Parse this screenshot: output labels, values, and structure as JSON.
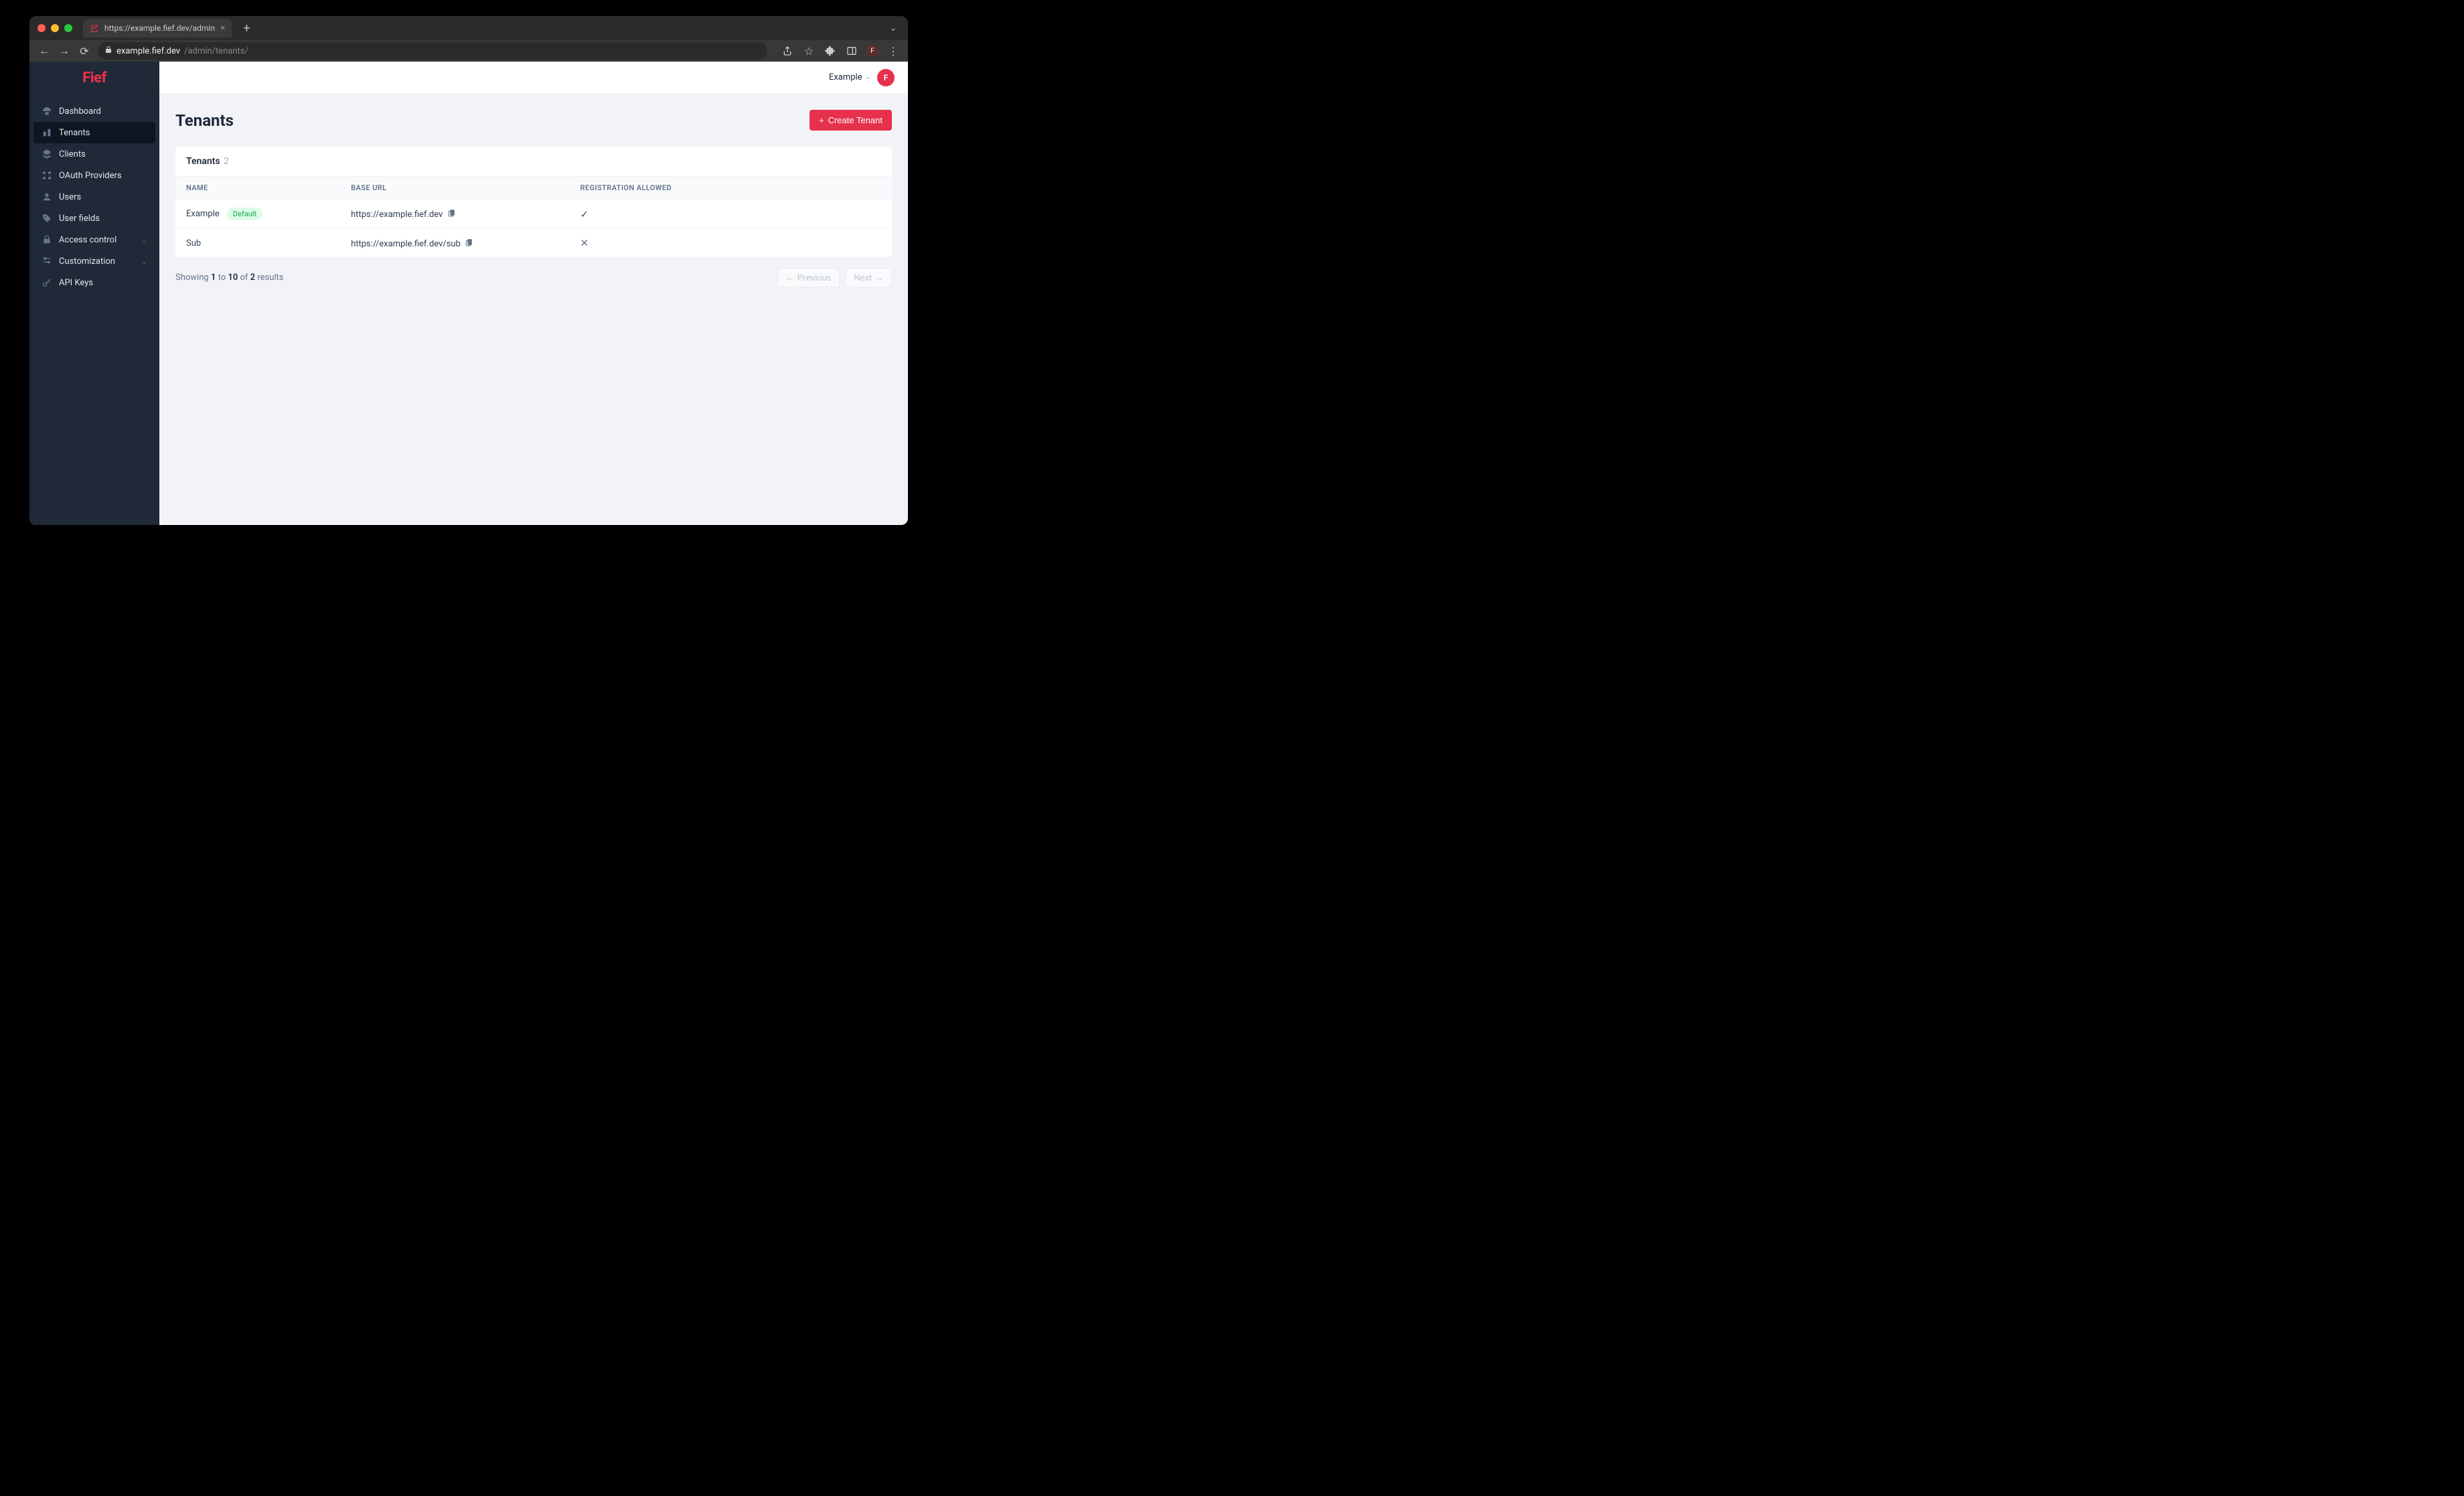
{
  "browser": {
    "tab_title": "https://example.fief.dev/admin",
    "url_domain": "example.fief.dev",
    "url_path": "/admin/tenants/",
    "profile_letter": "F"
  },
  "logo": "Fief",
  "sidebar": {
    "items": [
      {
        "icon": "dashboard",
        "label": "Dashboard"
      },
      {
        "icon": "tenants",
        "label": "Tenants",
        "active": true
      },
      {
        "icon": "clients",
        "label": "Clients"
      },
      {
        "icon": "oauth",
        "label": "OAuth Providers"
      },
      {
        "icon": "users",
        "label": "Users"
      },
      {
        "icon": "userfields",
        "label": "User fields"
      },
      {
        "icon": "access",
        "label": "Access control",
        "expandable": true
      },
      {
        "icon": "customization",
        "label": "Customization",
        "expandable": true
      },
      {
        "icon": "apikeys",
        "label": "API Keys"
      }
    ]
  },
  "topbar": {
    "workspace_label": "Example",
    "avatar_letter": "F"
  },
  "page": {
    "title": "Tenants",
    "create_button": "Create Tenant",
    "card_title": "Tenants",
    "card_count": "2",
    "columns": {
      "name": "NAME",
      "base_url": "BASE URL",
      "registration": "REGISTRATION ALLOWED"
    },
    "rows": [
      {
        "name": "Example",
        "default": true,
        "badge": "Default",
        "base_url": "https://example.fief.dev",
        "registration": true
      },
      {
        "name": "Sub",
        "default": false,
        "base_url": "https://example.fief.dev/sub",
        "registration": false
      }
    ],
    "pagination": {
      "showing": "Showing",
      "from": "1",
      "to_label": "to",
      "to": "10",
      "of_label": "of",
      "total": "2",
      "results": "results",
      "previous": "Previous",
      "next": "Next"
    }
  }
}
